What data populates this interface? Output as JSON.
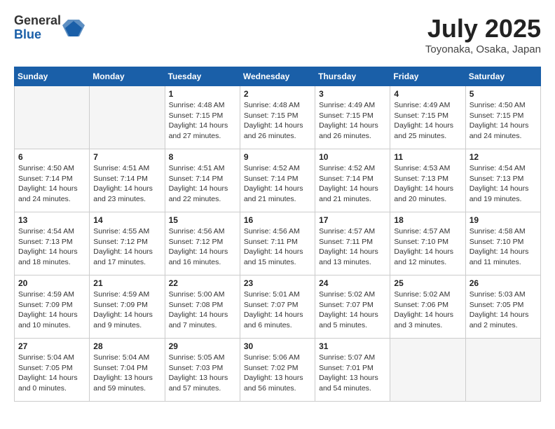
{
  "header": {
    "logo_general": "General",
    "logo_blue": "Blue",
    "month_title": "July 2025",
    "location": "Toyonaka, Osaka, Japan"
  },
  "weekdays": [
    "Sunday",
    "Monday",
    "Tuesday",
    "Wednesday",
    "Thursday",
    "Friday",
    "Saturday"
  ],
  "weeks": [
    [
      {
        "day": "",
        "info": ""
      },
      {
        "day": "",
        "info": ""
      },
      {
        "day": "1",
        "info": "Sunrise: 4:48 AM\nSunset: 7:15 PM\nDaylight: 14 hours and 27 minutes."
      },
      {
        "day": "2",
        "info": "Sunrise: 4:48 AM\nSunset: 7:15 PM\nDaylight: 14 hours and 26 minutes."
      },
      {
        "day": "3",
        "info": "Sunrise: 4:49 AM\nSunset: 7:15 PM\nDaylight: 14 hours and 26 minutes."
      },
      {
        "day": "4",
        "info": "Sunrise: 4:49 AM\nSunset: 7:15 PM\nDaylight: 14 hours and 25 minutes."
      },
      {
        "day": "5",
        "info": "Sunrise: 4:50 AM\nSunset: 7:15 PM\nDaylight: 14 hours and 24 minutes."
      }
    ],
    [
      {
        "day": "6",
        "info": "Sunrise: 4:50 AM\nSunset: 7:14 PM\nDaylight: 14 hours and 24 minutes."
      },
      {
        "day": "7",
        "info": "Sunrise: 4:51 AM\nSunset: 7:14 PM\nDaylight: 14 hours and 23 minutes."
      },
      {
        "day": "8",
        "info": "Sunrise: 4:51 AM\nSunset: 7:14 PM\nDaylight: 14 hours and 22 minutes."
      },
      {
        "day": "9",
        "info": "Sunrise: 4:52 AM\nSunset: 7:14 PM\nDaylight: 14 hours and 21 minutes."
      },
      {
        "day": "10",
        "info": "Sunrise: 4:52 AM\nSunset: 7:14 PM\nDaylight: 14 hours and 21 minutes."
      },
      {
        "day": "11",
        "info": "Sunrise: 4:53 AM\nSunset: 7:13 PM\nDaylight: 14 hours and 20 minutes."
      },
      {
        "day": "12",
        "info": "Sunrise: 4:54 AM\nSunset: 7:13 PM\nDaylight: 14 hours and 19 minutes."
      }
    ],
    [
      {
        "day": "13",
        "info": "Sunrise: 4:54 AM\nSunset: 7:13 PM\nDaylight: 14 hours and 18 minutes."
      },
      {
        "day": "14",
        "info": "Sunrise: 4:55 AM\nSunset: 7:12 PM\nDaylight: 14 hours and 17 minutes."
      },
      {
        "day": "15",
        "info": "Sunrise: 4:56 AM\nSunset: 7:12 PM\nDaylight: 14 hours and 16 minutes."
      },
      {
        "day": "16",
        "info": "Sunrise: 4:56 AM\nSunset: 7:11 PM\nDaylight: 14 hours and 15 minutes."
      },
      {
        "day": "17",
        "info": "Sunrise: 4:57 AM\nSunset: 7:11 PM\nDaylight: 14 hours and 13 minutes."
      },
      {
        "day": "18",
        "info": "Sunrise: 4:57 AM\nSunset: 7:10 PM\nDaylight: 14 hours and 12 minutes."
      },
      {
        "day": "19",
        "info": "Sunrise: 4:58 AM\nSunset: 7:10 PM\nDaylight: 14 hours and 11 minutes."
      }
    ],
    [
      {
        "day": "20",
        "info": "Sunrise: 4:59 AM\nSunset: 7:09 PM\nDaylight: 14 hours and 10 minutes."
      },
      {
        "day": "21",
        "info": "Sunrise: 4:59 AM\nSunset: 7:09 PM\nDaylight: 14 hours and 9 minutes."
      },
      {
        "day": "22",
        "info": "Sunrise: 5:00 AM\nSunset: 7:08 PM\nDaylight: 14 hours and 7 minutes."
      },
      {
        "day": "23",
        "info": "Sunrise: 5:01 AM\nSunset: 7:07 PM\nDaylight: 14 hours and 6 minutes."
      },
      {
        "day": "24",
        "info": "Sunrise: 5:02 AM\nSunset: 7:07 PM\nDaylight: 14 hours and 5 minutes."
      },
      {
        "day": "25",
        "info": "Sunrise: 5:02 AM\nSunset: 7:06 PM\nDaylight: 14 hours and 3 minutes."
      },
      {
        "day": "26",
        "info": "Sunrise: 5:03 AM\nSunset: 7:05 PM\nDaylight: 14 hours and 2 minutes."
      }
    ],
    [
      {
        "day": "27",
        "info": "Sunrise: 5:04 AM\nSunset: 7:05 PM\nDaylight: 14 hours and 0 minutes."
      },
      {
        "day": "28",
        "info": "Sunrise: 5:04 AM\nSunset: 7:04 PM\nDaylight: 13 hours and 59 minutes."
      },
      {
        "day": "29",
        "info": "Sunrise: 5:05 AM\nSunset: 7:03 PM\nDaylight: 13 hours and 57 minutes."
      },
      {
        "day": "30",
        "info": "Sunrise: 5:06 AM\nSunset: 7:02 PM\nDaylight: 13 hours and 56 minutes."
      },
      {
        "day": "31",
        "info": "Sunrise: 5:07 AM\nSunset: 7:01 PM\nDaylight: 13 hours and 54 minutes."
      },
      {
        "day": "",
        "info": ""
      },
      {
        "day": "",
        "info": ""
      }
    ]
  ]
}
